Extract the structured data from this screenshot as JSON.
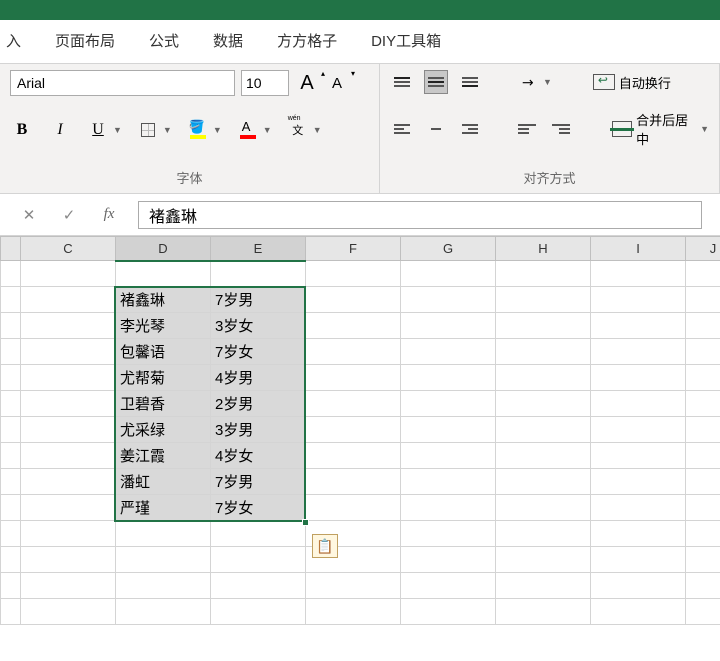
{
  "menu": {
    "items": [
      "入",
      "页面布局",
      "公式",
      "数据",
      "方方格子",
      "DIY工具箱"
    ]
  },
  "font": {
    "name": "Arial",
    "size": "10",
    "bold": "B",
    "italic": "I",
    "underline": "U",
    "wen": "文",
    "wen_top": "wén",
    "group_label": "字体"
  },
  "align": {
    "wrap_label": "自动换行",
    "merge_label": "合并后居中",
    "group_label": "对齐方式"
  },
  "formula_bar": {
    "fx": "fx",
    "value": "褚鑫琳"
  },
  "columns": [
    "C",
    "D",
    "E",
    "F",
    "G",
    "H",
    "I",
    "J"
  ],
  "selected_cols": [
    "D",
    "E"
  ],
  "table_data": [
    {
      "d": "褚鑫琳",
      "e": "7岁男"
    },
    {
      "d": "李光琴",
      "e": "3岁女"
    },
    {
      "d": "包馨语",
      "e": "7岁女"
    },
    {
      "d": "尤帮菊",
      "e": "4岁男"
    },
    {
      "d": "卫碧香",
      "e": "2岁男"
    },
    {
      "d": "尤采绿",
      "e": "3岁男"
    },
    {
      "d": "姜江霞",
      "e": "4岁女"
    },
    {
      "d": "潘虹",
      "e": "7岁男"
    },
    {
      "d": "严瑾",
      "e": "7岁女"
    }
  ]
}
